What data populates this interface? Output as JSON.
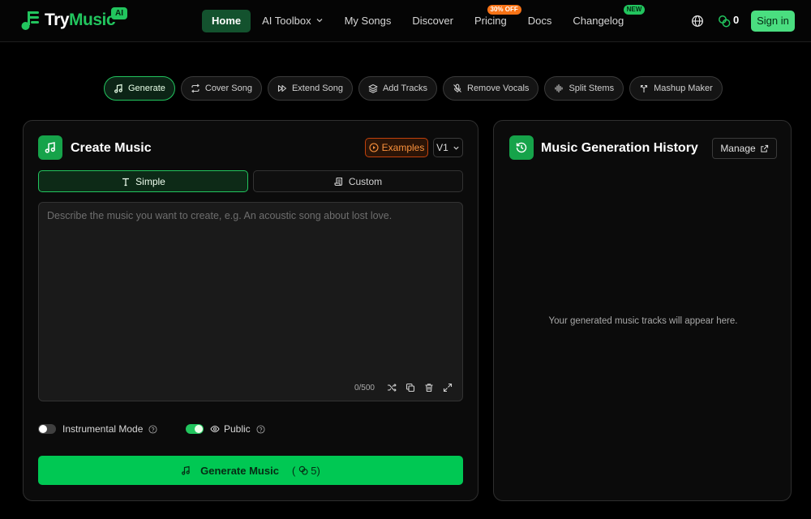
{
  "brand": {
    "name_part1": "Try",
    "name_part2": "Music",
    "badge": "AI"
  },
  "nav": {
    "links": [
      {
        "label": "Home",
        "active": true
      },
      {
        "label": "AI Toolbox",
        "dropdown": true
      },
      {
        "label": "My Songs"
      },
      {
        "label": "Discover"
      },
      {
        "label": "Pricing",
        "badge": "30% OFF"
      },
      {
        "label": "Docs"
      },
      {
        "label": "Changelog",
        "badge": "NEW"
      }
    ],
    "credits": "0",
    "signin_label": "Sign in"
  },
  "tools": [
    {
      "label": "Generate",
      "icon": "music-note-icon",
      "active": true
    },
    {
      "label": "Cover Song",
      "icon": "repeat-icon"
    },
    {
      "label": "Extend Song",
      "icon": "fast-forward-icon"
    },
    {
      "label": "Add Tracks",
      "icon": "layers-icon"
    },
    {
      "label": "Remove Vocals",
      "icon": "mic-off-icon"
    },
    {
      "label": "Split Stems",
      "icon": "audio-lines-icon"
    },
    {
      "label": "Mashup Maker",
      "icon": "merge-icon"
    }
  ],
  "create": {
    "title": "Create Music",
    "examples_label": "Examples",
    "version": "V1",
    "modes": {
      "simple": "Simple",
      "custom": "Custom"
    },
    "prompt_placeholder": "Describe the music you want to create, e.g. An acoustic song about lost love.",
    "char_count": "0/500",
    "instrumental_label": "Instrumental Mode",
    "public_label": "Public",
    "generate_label": "Generate Music",
    "generate_cost_open": "(",
    "generate_cost": "5)"
  },
  "history": {
    "title": "Music Generation History",
    "manage_label": "Manage",
    "empty_text": "Your generated music tracks will appear here."
  },
  "colors": {
    "accent": "#22c55e",
    "accent_button": "#00c853",
    "orange": "#f97316",
    "background": "#000000"
  }
}
